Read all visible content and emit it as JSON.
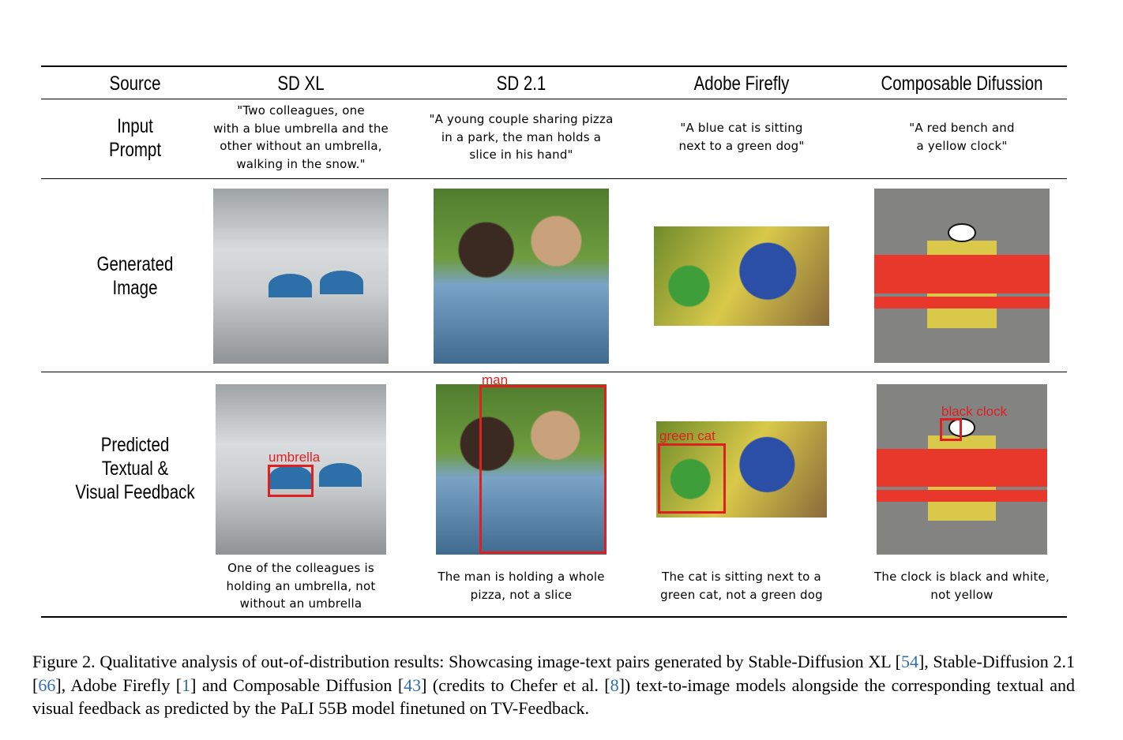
{
  "table": {
    "headers": [
      "Source",
      "SD XL",
      "SD 2.1",
      "Adobe Firefly",
      "Composable Difussion"
    ],
    "row_labels": {
      "input_prompt": [
        "Input",
        "Prompt"
      ],
      "generated_image": [
        "Generated",
        "Image"
      ],
      "feedback": [
        "Predicted",
        "Textual &",
        "Visual Feedback"
      ]
    },
    "prompts": [
      [
        "\"Two colleagues, one",
        "with a blue umbrella and the",
        "other without an umbrella,",
        "walking in the snow.\""
      ],
      [
        "\"A young couple sharing pizza",
        "in a park, the man holds a",
        "slice in his hand\""
      ],
      [
        "\"A blue cat is sitting",
        "next to a green dog\""
      ],
      [
        "\"A red bench and",
        "a yellow clock\""
      ]
    ],
    "bbox_labels": [
      "umbrella",
      "man",
      "green cat",
      "black clock"
    ],
    "feedback": [
      [
        "One of the colleagues is",
        "holding an umbrella, not",
        "without an umbrella"
      ],
      [
        "The man is holding a whole",
        "pizza, not a slice"
      ],
      [
        "The cat is sitting next to a",
        "green cat, not a green dog"
      ],
      [
        "The clock is black and white,",
        "not yellow"
      ]
    ],
    "box_color": "#e02020"
  },
  "caption": {
    "t1": "Figure 2.  Qualitative analysis of out-of-distribution results: Showcasing image-text pairs generated by Stable-Diffusion XL [",
    "c1": "54",
    "t2": "], Stable-Diffusion 2.1 [",
    "c2": "66",
    "t3": "], Adobe Firefly [",
    "c3": "1",
    "t4": "] and Composable Diffusion [",
    "c4": "43",
    "t5": "] (credits to Chefer et al. [",
    "c5": "8",
    "t6": "]) text-to-image models alongside the corresponding textual and visual feedback as predicted by the PaLI 55B model finetuned on TV-Feedback.",
    "cite_color": "#2f6db5"
  }
}
